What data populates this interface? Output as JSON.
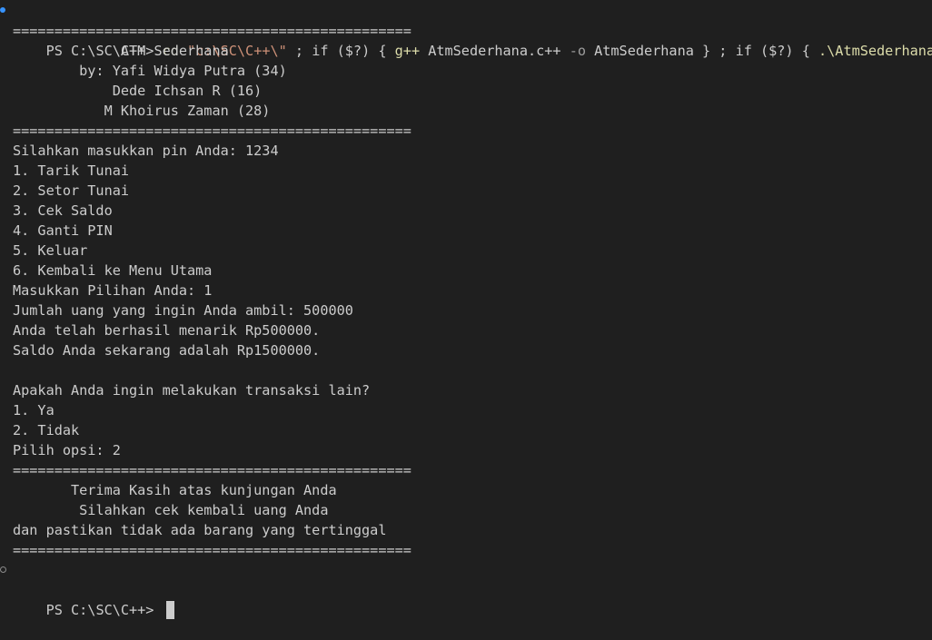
{
  "command_line": {
    "prompt": "PS C:\\SC\\C++> ",
    "parts": [
      {
        "text": "cd",
        "style": "yellow"
      },
      {
        "text": " ",
        "style": "default"
      },
      {
        "text": "\"c:\\SC\\C++\\\"",
        "style": "string"
      },
      {
        "text": " ; if ($?) { ",
        "style": "default"
      },
      {
        "text": "g++",
        "style": "yellow"
      },
      {
        "text": " AtmSederhana.c++ ",
        "style": "default"
      },
      {
        "text": "-o",
        "style": "param"
      },
      {
        "text": " AtmSederhana } ; if ($?) { ",
        "style": "default"
      },
      {
        "text": ".\\AtmSederhana",
        "style": "yellow"
      },
      {
        "text": " }",
        "style": "default"
      }
    ]
  },
  "output": {
    "separator": "================================================",
    "header": {
      "title": "             ATM Sederhana",
      "author_1": "        by: Yafi Widya Putra (34)",
      "author_2": "            Dede Ichsan R (16)",
      "author_3": "           M Khoirus Zaman (28)"
    },
    "pin_prompt": "Silahkan masukkan pin Anda: 1234",
    "menu": [
      "1. Tarik Tunai",
      "2. Setor Tunai",
      "3. Cek Saldo",
      "4. Ganti PIN",
      "5. Keluar",
      "6. Kembali ke Menu Utama"
    ],
    "choice_prompt": "Masukkan Pilihan Anda: 1",
    "amount_prompt": "Jumlah uang yang ingin Anda ambil: 500000",
    "withdraw_result": "Anda telah berhasil menarik Rp500000.",
    "balance_result": "Saldo Anda sekarang adalah Rp1500000.",
    "another_prompt": "Apakah Anda ingin melakukan transaksi lain?",
    "options": [
      "1. Ya",
      "2. Tidak"
    ],
    "option_choice": "Pilih opsi: 2",
    "thanks_1": "       Terima Kasih atas kunjungan Anda",
    "thanks_2": "        Silahkan cek kembali uang Anda",
    "thanks_3": "dan pastikan tidak ada barang yang tertinggal"
  },
  "final_prompt": "PS C:\\SC\\C++> ",
  "colors": {
    "background": "#1f1f1f",
    "text": "#cccccc",
    "command_yellow": "#dcdcaa",
    "string": "#ce9178",
    "status_dot": "#3794ff"
  }
}
